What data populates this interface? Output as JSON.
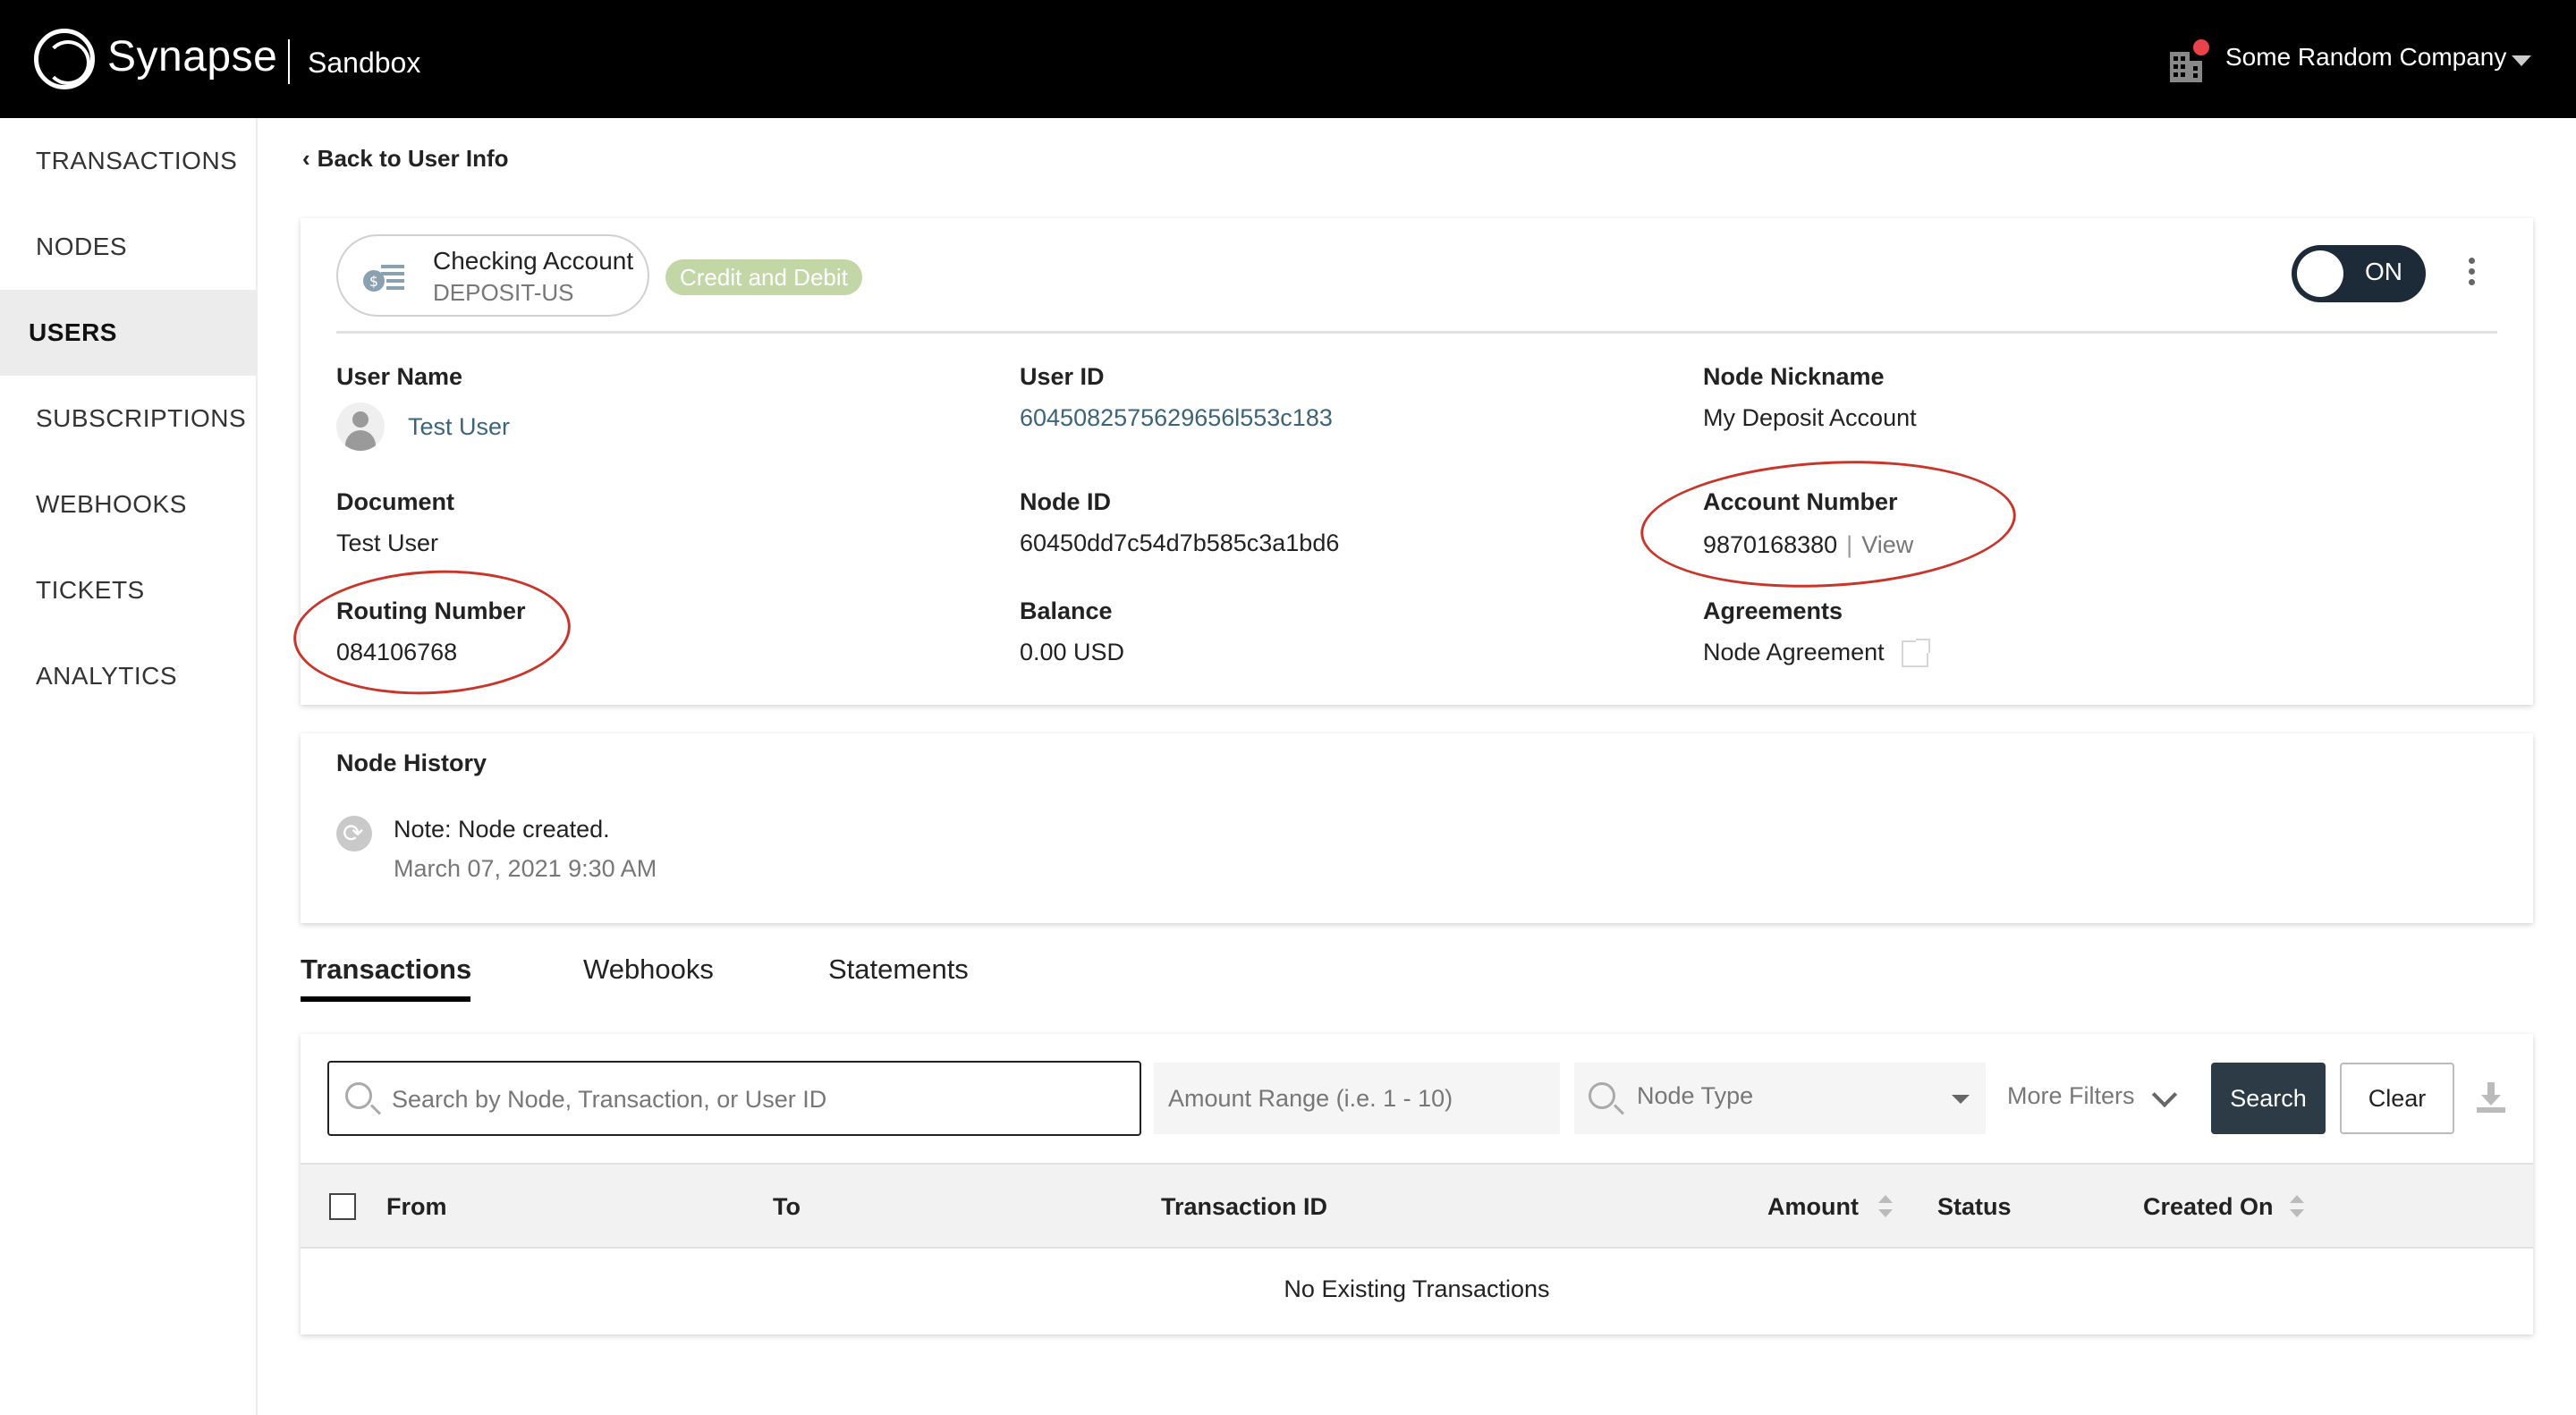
{
  "header": {
    "brand": "Synapse",
    "environment": "Sandbox",
    "company": "Some Random Company",
    "notify_color": "#e8434b"
  },
  "sidebar": {
    "items": [
      {
        "label": "TRANSACTIONS",
        "active": false
      },
      {
        "label": "NODES",
        "active": false
      },
      {
        "label": "USERS",
        "active": true
      },
      {
        "label": "SUBSCRIPTIONS",
        "active": false
      },
      {
        "label": "WEBHOOKS",
        "active": false
      },
      {
        "label": "TICKETS",
        "active": false
      },
      {
        "label": "ANALYTICS",
        "active": false
      }
    ]
  },
  "back_link": "Back to User Info",
  "node": {
    "account_type": "Checking Account",
    "account_sub": "DEPOSIT-US",
    "tag": "Credit and Debit",
    "tag_color": "#c3d7a6",
    "toggle_label": "ON",
    "fields": {
      "user_name_label": "User Name",
      "user_name": "Test User",
      "user_id_label": "User ID",
      "user_id": "6045082575629656l553c183",
      "nickname_label": "Node Nickname",
      "nickname": "My Deposit Account",
      "document_label": "Document",
      "document": "Test User",
      "node_id_label": "Node ID",
      "node_id": "60450dd7c54d7b585c3a1bd6",
      "account_number_label": "Account Number",
      "account_number": "9870168380",
      "account_sep": "|",
      "account_view": "View",
      "routing_label": "Routing Number",
      "routing": "084106768",
      "balance_label": "Balance",
      "balance": "0.00 USD",
      "agreements_label": "Agreements",
      "agreements": "Node Agreement"
    }
  },
  "history": {
    "title": "Node History",
    "note": "Note: Node created.",
    "date": "March 07, 2021 9:30 AM"
  },
  "tabs": [
    {
      "label": "Transactions",
      "active": true
    },
    {
      "label": "Webhooks",
      "active": false
    },
    {
      "label": "Statements",
      "active": false
    }
  ],
  "filters": {
    "search_placeholder": "Search by Node, Transaction, or User ID",
    "amount_placeholder": "Amount Range (i.e. 1 - 10)",
    "node_type": "Node Type",
    "more_filters": "More Filters",
    "search_button": "Search",
    "clear_button": "Clear"
  },
  "table": {
    "columns": [
      "From",
      "To",
      "Transaction ID",
      "Amount",
      "Status",
      "Created On"
    ],
    "empty_message": "No Existing Transactions"
  },
  "annotation_color": "#c8362b"
}
